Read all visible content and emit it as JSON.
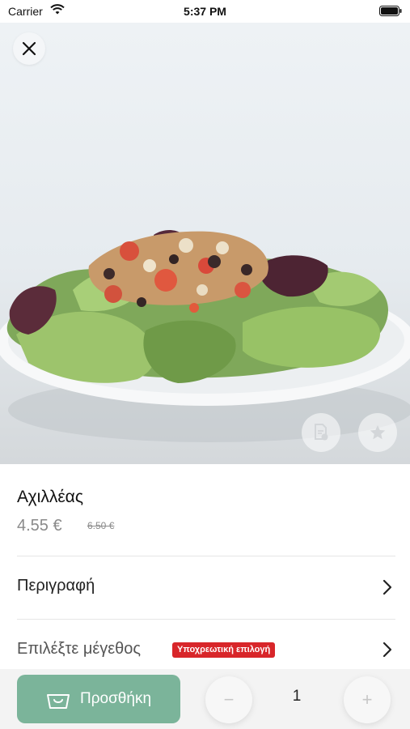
{
  "status_bar": {
    "carrier": "Carrier",
    "time": "5:37 PM"
  },
  "product": {
    "name": "Αχιλλέας",
    "price": "4.55 €",
    "old_price": "6.50 €"
  },
  "rows": {
    "description_label": "Περιγραφή",
    "size_label": "Επιλέξτε μέγεθος",
    "required_badge": "Υποχρεωτική επιλογή"
  },
  "bottom": {
    "add_label": "Προσθήκη",
    "quantity": "1"
  },
  "icons": {
    "close": "close-icon",
    "info": "document-info-icon",
    "favorite": "star-icon",
    "cart": "shopping-basket-icon",
    "chevron": "chevron-right-icon"
  },
  "colors": {
    "accent": "#7bb49a",
    "badge": "#d8262a",
    "price": "#8a8a8a"
  }
}
